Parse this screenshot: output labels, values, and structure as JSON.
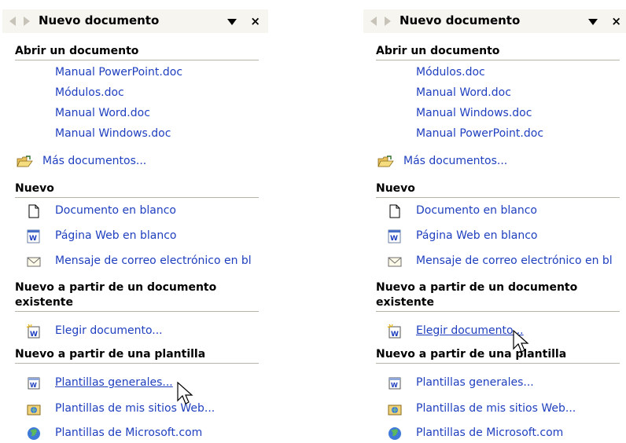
{
  "panels": [
    {
      "title": "Nuevo documento",
      "close_label": "×",
      "open_heading": "Abrir un documento",
      "recent": [
        "Manual PowerPoint.doc",
        "Módulos.doc",
        "Manual Word.doc",
        "Manual Windows.doc"
      ],
      "more": "Más documentos...",
      "new_heading": "Nuevo",
      "new_items": [
        "Documento en blanco",
        "Página Web en blanco",
        "Mensaje de correo electrónico en bl"
      ],
      "existing_heading": "Nuevo a partir de un documento existente",
      "choose": "Elegir documento...",
      "template_heading": "Nuevo a partir de una plantilla",
      "templates": [
        "Plantillas generales...",
        "Plantillas de mis sitios Web...",
        "Plantillas de Microsoft.com"
      ]
    },
    {
      "title": "Nuevo documento",
      "close_label": "×",
      "open_heading": "Abrir un documento",
      "recent": [
        "Módulos.doc",
        "Manual Word.doc",
        "Manual Windows.doc",
        "Manual PowerPoint.doc"
      ],
      "more": "Más documentos...",
      "new_heading": "Nuevo",
      "new_items": [
        "Documento en blanco",
        "Página Web en blanco",
        "Mensaje de correo electrónico en bl"
      ],
      "existing_heading": "Nuevo a partir de un documento existente",
      "choose": "Elegir documento...",
      "template_heading": "Nuevo a partir de una plantilla",
      "templates": [
        "Plantillas generales...",
        "Plantillas de mis sitios Web...",
        "Plantillas de Microsoft.com"
      ]
    }
  ]
}
